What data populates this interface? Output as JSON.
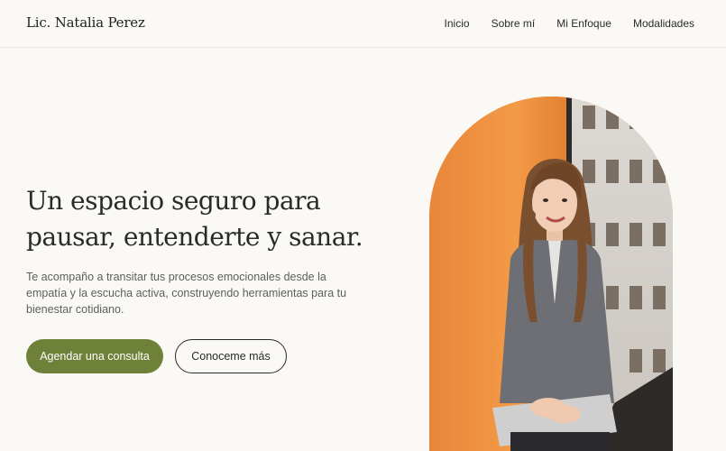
{
  "header": {
    "logo": "Lic. Natalia Perez",
    "nav": [
      "Inicio",
      "Sobre mí",
      "Mi Enfoque",
      "Modalidades"
    ]
  },
  "hero": {
    "title_line1": "Un espacio seguro para",
    "title_line2": "pausar, entenderte y sanar.",
    "text_line1": "Te acompaño a transitar tus procesos emocionales desde la",
    "text_line2": "empatía y la escucha activa, construyendo herramientas para tu",
    "text_line3": "bienestar cotidiano.",
    "primary_cta": "Agendar una consulta",
    "secondary_cta": "Conoceme más"
  },
  "colors": {
    "background": "#fbf9f5",
    "primary_button": "#6f8039",
    "orange_wall": "#f08f3e"
  }
}
